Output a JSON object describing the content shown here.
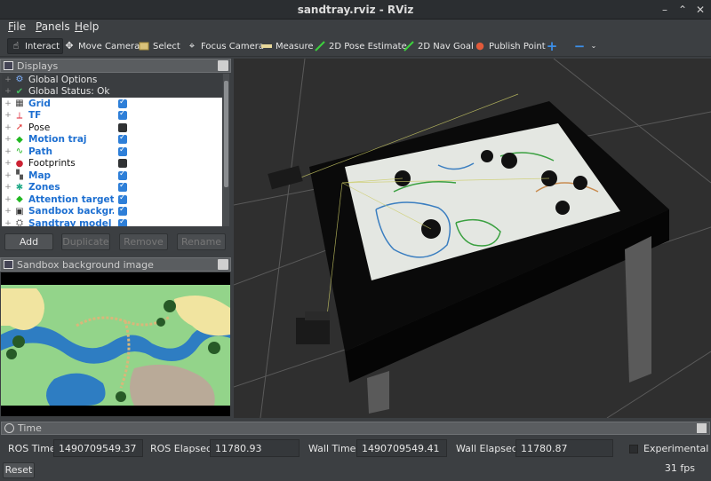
{
  "window": {
    "title": "sandtray.rviz - RViz"
  },
  "menu": [
    "File",
    "Panels",
    "Help"
  ],
  "toolbar": {
    "tools": [
      {
        "label": "Interact",
        "icon": "hand-icon",
        "active": true
      },
      {
        "label": "Move Camera",
        "icon": "move-camera-icon",
        "active": false
      },
      {
        "label": "Select",
        "icon": "select-icon",
        "active": false
      },
      {
        "label": "Focus Camera",
        "icon": "crosshair-icon",
        "active": false
      },
      {
        "label": "Measure",
        "icon": "ruler-icon",
        "active": false
      },
      {
        "label": "2D Pose Estimate",
        "icon": "green-arrow-icon",
        "active": false
      },
      {
        "label": "2D Nav Goal",
        "icon": "green-arrow-icon",
        "active": false
      },
      {
        "label": "Publish Point",
        "icon": "map-pin-icon",
        "active": false
      }
    ]
  },
  "displays": {
    "title": "Displays",
    "items": [
      {
        "label": "Global Options",
        "icon": "gear-icon",
        "checked": null,
        "style": "header"
      },
      {
        "label": "Global Status: Ok",
        "icon": "check-icon",
        "checked": null,
        "style": "header"
      },
      {
        "label": "Grid",
        "icon": "grid-icon",
        "checked": true,
        "style": "blue"
      },
      {
        "label": "TF",
        "icon": "tf-axes-icon",
        "checked": true,
        "style": "blue"
      },
      {
        "label": "Pose",
        "icon": "red-arrow-icon",
        "checked": false,
        "style": "black"
      },
      {
        "label": "Motion traj",
        "icon": "green-cube-icon",
        "checked": true,
        "style": "blue"
      },
      {
        "label": "Path",
        "icon": "green-path-icon",
        "checked": true,
        "style": "blue"
      },
      {
        "label": "Footprints",
        "icon": "footprints-icon",
        "checked": false,
        "style": "black"
      },
      {
        "label": "Map",
        "icon": "map-icon",
        "checked": true,
        "style": "blue"
      },
      {
        "label": "Zones",
        "icon": "zones-icon",
        "checked": true,
        "style": "blue"
      },
      {
        "label": "Attention targets",
        "icon": "green-cube-icon",
        "checked": true,
        "style": "blue"
      },
      {
        "label": "Sandbox backgr...",
        "icon": "image-icon",
        "checked": true,
        "style": "blue"
      },
      {
        "label": "Sandtray model",
        "icon": "model-icon",
        "checked": true,
        "style": "blue"
      }
    ],
    "buttons": [
      {
        "label": "Add",
        "enabled": true
      },
      {
        "label": "Duplicate",
        "enabled": false
      },
      {
        "label": "Remove",
        "enabled": false
      },
      {
        "label": "Rename",
        "enabled": false
      }
    ]
  },
  "image_panel": {
    "title": "Sandbox background image"
  },
  "time_panel": {
    "title": "Time",
    "ros_time_label": "ROS Time:",
    "ros_time": "1490709549.37",
    "ros_elapsed_label": "ROS Elapsed:",
    "ros_elapsed": "11780.93",
    "wall_time_label": "Wall Time:",
    "wall_time": "1490709549.41",
    "wall_elapsed_label": "Wall Elapsed:",
    "wall_elapsed": "11780.87",
    "experimental_label": "Experimental",
    "experimental_checked": false,
    "reset_label": "Reset",
    "fps": "31 fps"
  },
  "colors": {
    "background": "#3c3f42",
    "tree_background": "#ffffff",
    "link_blue": "#1d6fd1",
    "checkbox_blue": "#2e7fd8",
    "view_background": "#2f2f2f"
  }
}
